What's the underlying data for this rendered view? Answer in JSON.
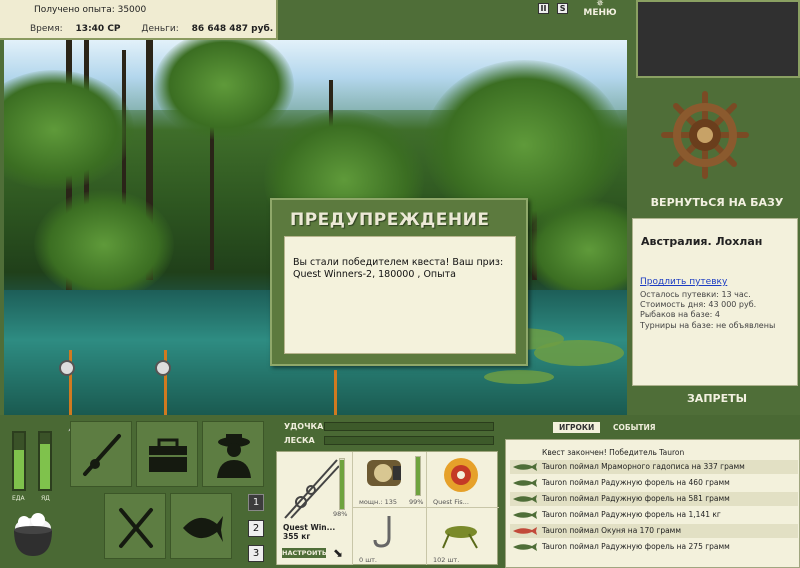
{
  "info": {
    "experience": "Получено опыта: 35000",
    "time_label": "Время:",
    "time_value": "13:40 СР",
    "money_label": "Деньги:",
    "money_value": "86 648 487 руб."
  },
  "top": {
    "pause_label": "II",
    "sound_label": "S",
    "menu_label": "МЕНЮ"
  },
  "dialog": {
    "title": "ПРЕДУПРЕЖДЕНИЕ",
    "message": "Вы стали победителем квеста! Ваш приз: Quest Winners-2, 180000 , Опыта"
  },
  "right_panel": {
    "return_label": "ВЕРНУТЬСЯ НА БАЗУ",
    "location": "Австралия. Лохлан",
    "extend_link": "Продлить путевку",
    "lines": [
      "Осталось путевки: 13 час.",
      "Стоимость дня: 43 000 руб.",
      "Рыбаков на базе: 4",
      "Турниры на базе: не объявлены"
    ],
    "bans_label": "ЗАПРЕТЫ"
  },
  "gauges": {
    "food_label": "ЕДА",
    "poison_label": "ЯД",
    "food_level": 0.7,
    "poison_level": 0.8
  },
  "pages": [
    "1",
    "2",
    "3"
  ],
  "gear": {
    "rod_label": "УДОЧКА",
    "line_label": "ЛЕСКА"
  },
  "tackle": {
    "rod_name": "Quest Win...",
    "rod_weight": "355 кг",
    "rod_percent": "98%",
    "setup_label": "НАСТРОИТЬ",
    "reel_power": "мощн.: 135",
    "reel_percent": "99%",
    "line_name": "Quest Fis...",
    "hook_count": "0 шт.",
    "bait_count": "102 шт."
  },
  "events": {
    "tab_players": "ИГРОКИ",
    "tab_events": "СОБЫТИЯ",
    "header": "Квест закончен! Победитель Tauron",
    "rows": [
      "Tauron поймал Мраморного гадописа на 337 грамм",
      "Tauron поймал Радужную форель на 460 грамм",
      "Tauron поймал Радужную форель на 581 грамм",
      "Tauron поймал Радужную форель на 1,141 кг",
      "Tauron поймал Окуня на 170 грамм",
      "Tauron поймал Радужную форель на 275 грамм"
    ]
  },
  "colors": {
    "panel_green": "#4f6e38",
    "panel_cream": "#f3f1dc",
    "link_blue": "#1b3cc2",
    "gauge_fill": "#7fc24c"
  }
}
